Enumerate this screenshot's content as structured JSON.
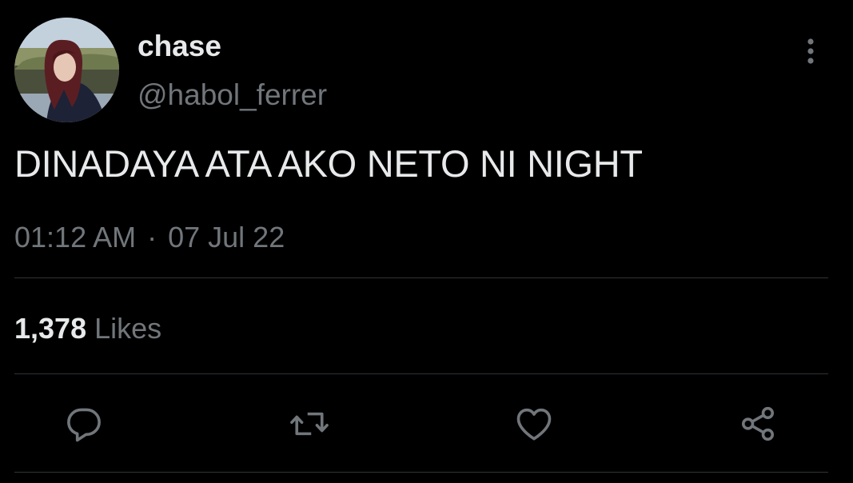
{
  "user": {
    "display_name": "chase",
    "handle": "@habol_ferrer"
  },
  "tweet": {
    "text": "DINADAYA ATA AKO NETO NI NIGHT",
    "time": "01:12 AM",
    "separator": "·",
    "date": "07 Jul 22"
  },
  "stats": {
    "likes_count": "1,378",
    "likes_label": "Likes"
  },
  "icons": {
    "more": "more-vertical-icon",
    "reply": "reply-icon",
    "retweet": "retweet-icon",
    "like": "heart-icon",
    "share": "share-icon"
  },
  "colors": {
    "background": "#000000",
    "primary_text": "#e7e9ea",
    "secondary_text": "#71767b",
    "divider": "#2f3336"
  }
}
